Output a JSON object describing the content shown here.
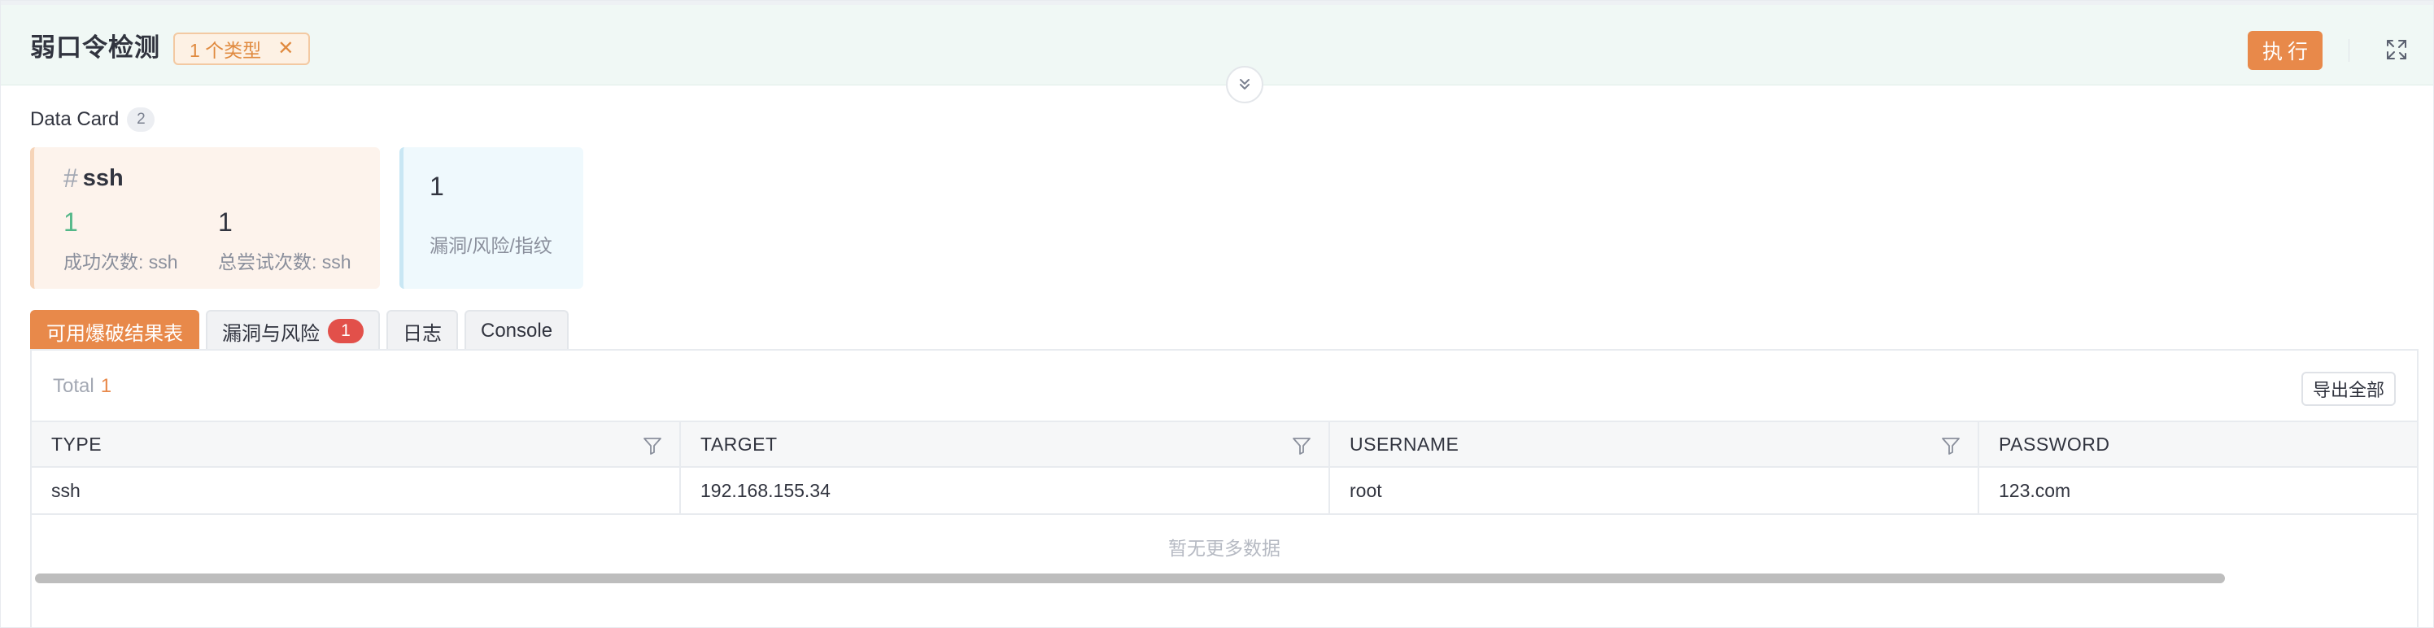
{
  "header": {
    "title": "弱口令检测",
    "type_tag": "1 个类型",
    "type_tag_close": "✕",
    "exec_label": "执行"
  },
  "data_card": {
    "label": "Data Card",
    "count": "2",
    "cards": [
      {
        "hash": "#",
        "title": "ssh",
        "stats": [
          {
            "value": "1",
            "label": "成功次数: ssh"
          },
          {
            "value": "1",
            "label": "总尝试次数: ssh"
          }
        ]
      },
      {
        "stats": [
          {
            "value": "1",
            "label": "漏洞/风险/指纹"
          }
        ]
      }
    ]
  },
  "tabs": [
    {
      "label": "可用爆破结果表",
      "active": true
    },
    {
      "label": "漏洞与风险",
      "badge": "1"
    },
    {
      "label": "日志"
    },
    {
      "label": "Console"
    }
  ],
  "table": {
    "total_label": "Total",
    "total_value": "1",
    "export_label": "导出全部",
    "columns": [
      "TYPE",
      "TARGET",
      "USERNAME",
      "PASSWORD"
    ],
    "rows": [
      [
        "ssh",
        "192.168.155.34",
        "root",
        "123.com"
      ]
    ],
    "empty_text": "暂无更多数据"
  },
  "colors": {
    "accent": "#e8894a",
    "success": "#52b788",
    "danger_badge": "#e2504a",
    "header_bg": "#f0f8f5"
  },
  "icons": {
    "close": "close-icon",
    "fullscreen": "expand-icon",
    "collapse": "chevron-double-down-icon",
    "filter": "filter-icon"
  }
}
